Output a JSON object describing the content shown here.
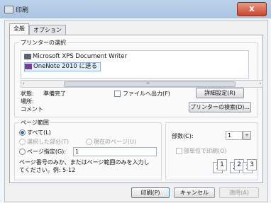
{
  "window": {
    "title": "印刷",
    "close_label": "x"
  },
  "tabs": [
    {
      "label": "全般"
    },
    {
      "label": "オプション"
    }
  ],
  "printer_select": {
    "group_label": "プリンターの選択",
    "printers": [
      {
        "name": "Microsoft XPS Document Writer"
      },
      {
        "name": "OneNote 2010 に送る"
      }
    ],
    "scrollbar_arrow_left": "‹",
    "scrollbar_grip": "≡",
    "scrollbar_arrow_right": "›",
    "status_label": "状態:",
    "status_value": "準備完了",
    "location_label": "場所:",
    "comment_label": "コメント",
    "print_to_file_label": "ファイルへ出力(F)",
    "preferences_button": "詳細設定(R)",
    "find_printer_button": "プリンターの検索(D)..."
  },
  "page_range": {
    "group_label": "ページ範囲",
    "all_label": "すべて(L)",
    "selection_label": "選択した部分(T)",
    "current_page_label": "現在のページ(U)",
    "pages_label": "ページ指定(G):",
    "pages_value": "1",
    "hint_line1": "ページ番号のみか、またはページ範囲のみを入力し",
    "hint_line2": "てください。例: 5-12"
  },
  "copies": {
    "copies_label": "部数(C):",
    "copies_value": "1",
    "spinner_symbol": "÷",
    "collate_label": "部単位で印刷(O)",
    "collate_pages": [
      "1",
      "1",
      "2",
      "2",
      "3",
      "3"
    ]
  },
  "footer": {
    "print_button": "印刷(P)",
    "cancel_button": "キャンセル",
    "apply_button": "適用(A)"
  }
}
